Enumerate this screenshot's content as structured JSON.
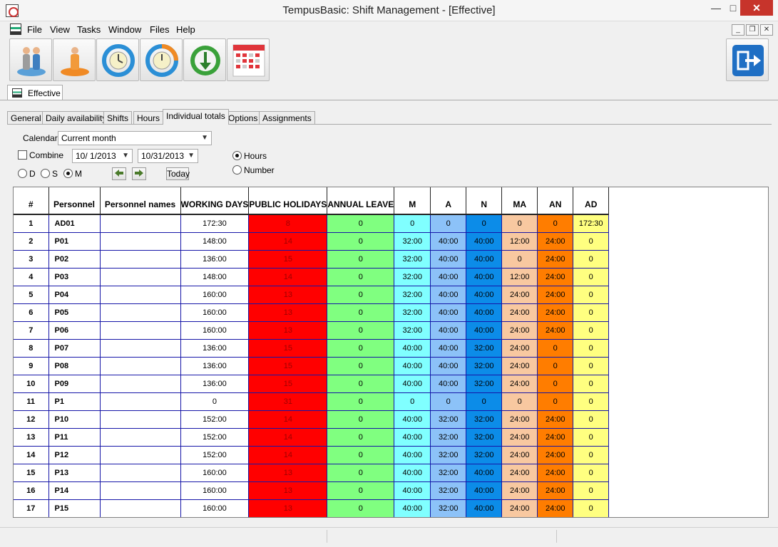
{
  "window": {
    "title": "TempusBasic: Shift Management - [Effective]"
  },
  "menu": [
    "File",
    "View",
    "Tasks",
    "Window",
    "Files",
    "Help"
  ],
  "toolbar": {
    "buttons": [
      "personnel-group-icon",
      "personnel-icon",
      "shift-rotation-icon",
      "rotation-clock-icon",
      "download-clock-icon",
      "calendar-icon"
    ],
    "exit_icon": "exit-icon"
  },
  "document_tab": {
    "label": "Effective"
  },
  "tabs": [
    "General",
    "Daily availability",
    "Shifts",
    "Hours",
    "Individual totals",
    "Options",
    "Assignments"
  ],
  "active_tab": "Individual totals",
  "filters": {
    "calendar_label": "Calendar",
    "calendar_value": "Current month",
    "combine_label": "Combine",
    "combine_checked": false,
    "date_from": "10/ 1/2013",
    "date_to": "10/31/2013",
    "period_options": [
      "D",
      "S",
      "M"
    ],
    "period_selected": "M",
    "today_label": "Today",
    "unit_options": [
      "Hours",
      "Number"
    ],
    "unit_selected": "Hours"
  },
  "table": {
    "headers": [
      "#",
      "Personnel",
      "Personnel names",
      "WORKING DAYS",
      "PUBLIC HOLIDAYS",
      "ANNUAL LEAVE",
      "M",
      "A",
      "N",
      "MA",
      "AN",
      "AD"
    ],
    "rows": [
      [
        "1",
        "AD01",
        "",
        "172:30",
        "8",
        "0",
        "0",
        "0",
        "0",
        "0",
        "0",
        "172:30"
      ],
      [
        "2",
        "P01",
        "",
        "148:00",
        "14",
        "0",
        "32:00",
        "40:00",
        "40:00",
        "12:00",
        "24:00",
        "0"
      ],
      [
        "3",
        "P02",
        "",
        "136:00",
        "15",
        "0",
        "32:00",
        "40:00",
        "40:00",
        "0",
        "24:00",
        "0"
      ],
      [
        "4",
        "P03",
        "",
        "148:00",
        "14",
        "0",
        "32:00",
        "40:00",
        "40:00",
        "12:00",
        "24:00",
        "0"
      ],
      [
        "5",
        "P04",
        "",
        "160:00",
        "13",
        "0",
        "32:00",
        "40:00",
        "40:00",
        "24:00",
        "24:00",
        "0"
      ],
      [
        "6",
        "P05",
        "",
        "160:00",
        "13",
        "0",
        "32:00",
        "40:00",
        "40:00",
        "24:00",
        "24:00",
        "0"
      ],
      [
        "7",
        "P06",
        "",
        "160:00",
        "13",
        "0",
        "32:00",
        "40:00",
        "40:00",
        "24:00",
        "24:00",
        "0"
      ],
      [
        "8",
        "P07",
        "",
        "136:00",
        "15",
        "0",
        "40:00",
        "40:00",
        "32:00",
        "24:00",
        "0",
        "0"
      ],
      [
        "9",
        "P08",
        "",
        "136:00",
        "15",
        "0",
        "40:00",
        "40:00",
        "32:00",
        "24:00",
        "0",
        "0"
      ],
      [
        "10",
        "P09",
        "",
        "136:00",
        "15",
        "0",
        "40:00",
        "40:00",
        "32:00",
        "24:00",
        "0",
        "0"
      ],
      [
        "11",
        "P1",
        "",
        "0",
        "31",
        "0",
        "0",
        "0",
        "0",
        "0",
        "0",
        "0"
      ],
      [
        "12",
        "P10",
        "",
        "152:00",
        "14",
        "0",
        "40:00",
        "32:00",
        "32:00",
        "24:00",
        "24:00",
        "0"
      ],
      [
        "13",
        "P11",
        "",
        "152:00",
        "14",
        "0",
        "40:00",
        "32:00",
        "32:00",
        "24:00",
        "24:00",
        "0"
      ],
      [
        "14",
        "P12",
        "",
        "152:00",
        "14",
        "0",
        "40:00",
        "32:00",
        "32:00",
        "24:00",
        "24:00",
        "0"
      ],
      [
        "15",
        "P13",
        "",
        "160:00",
        "13",
        "0",
        "40:00",
        "32:00",
        "40:00",
        "24:00",
        "24:00",
        "0"
      ],
      [
        "16",
        "P14",
        "",
        "160:00",
        "13",
        "0",
        "40:00",
        "32:00",
        "40:00",
        "24:00",
        "24:00",
        "0"
      ],
      [
        "17",
        "P15",
        "",
        "160:00",
        "13",
        "0",
        "40:00",
        "32:00",
        "40:00",
        "24:00",
        "24:00",
        "0"
      ]
    ],
    "column_colors": [
      "#ffffff",
      "#ffffff",
      "#ffffff",
      "#ffffff",
      "#ff0000",
      "#80ff80",
      "#80ffff",
      "#8cc2f8",
      "#0c8ce8",
      "#f8c8a0",
      "#ff7d00",
      "#ffff80"
    ]
  }
}
